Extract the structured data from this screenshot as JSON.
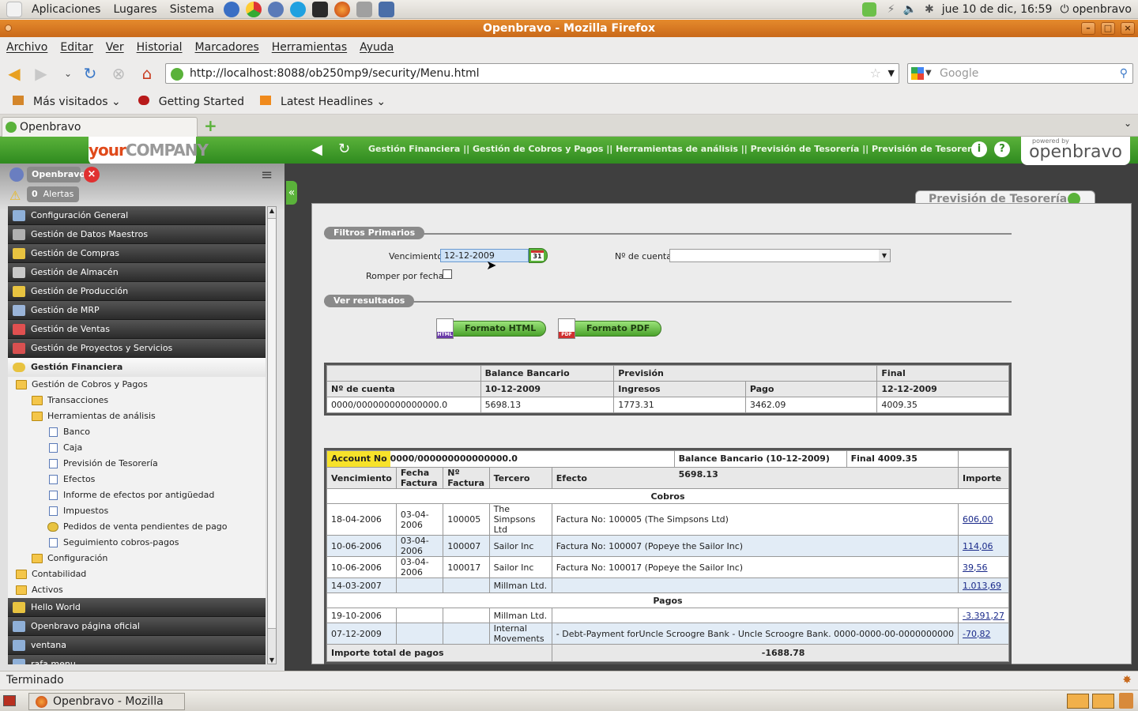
{
  "panel": {
    "menus": [
      "Aplicaciones",
      "Lugares",
      "Sistema"
    ],
    "datetime": "jue 10 de dic, 16:59",
    "user": "openbravo"
  },
  "window_title": "Openbravo - Mozilla Firefox",
  "firefox": {
    "menus": [
      "Archivo",
      "Editar",
      "Ver",
      "Historial",
      "Marcadores",
      "Herramientas",
      "Ayuda"
    ],
    "url": "http://localhost:8088/ob250mp9/security/Menu.html",
    "search_placeholder": "Google",
    "bookmarks": [
      "Más visitados",
      "Getting Started",
      "Latest Headlines"
    ],
    "tab_title": "Openbravo",
    "status": "Terminado",
    "taskbar_item": "Openbravo - Mozilla Fi..."
  },
  "ob": {
    "logo_your": "your",
    "logo_company": "COMPANY",
    "breadcrumb": "Gestión Financiera || Gestión de Cobros y Pagos || Herramientas de análisis || Previsión de Tesorería  ||  Previsión de Tesorería",
    "powered_by": "powered by",
    "powered_brand": "openbravo",
    "user": "Openbravo",
    "alerts_count": "0",
    "alerts_label": "Alertas",
    "window_tab": "Previsión de Tesorería"
  },
  "menu": {
    "top": [
      {
        "label": "Configuración General",
        "color": "#8fb0d8"
      },
      {
        "label": "Gestión de Datos Maestros",
        "color": "#b0b0b0"
      },
      {
        "label": "Gestión de Compras",
        "color": "#e8c340"
      },
      {
        "label": "Gestión de Almacén",
        "color": "#c8c8c8"
      },
      {
        "label": "Gestión de Producción",
        "color": "#e8c340"
      },
      {
        "label": "Gestión de MRP",
        "color": "#9ab4d8"
      },
      {
        "label": "Gestión de Ventas",
        "color": "#e05050"
      },
      {
        "label": "Gestión de Proyectos y Servicios",
        "color": "#d85050"
      }
    ],
    "finance_label": "Gestión Financiera",
    "tree": [
      {
        "label": "Gestión de Cobros y Pagos",
        "indent": 0,
        "kind": "fold"
      },
      {
        "label": "Transacciones",
        "indent": 1,
        "kind": "fold"
      },
      {
        "label": "Herramientas de análisis",
        "indent": 1,
        "kind": "fold"
      },
      {
        "label": "Banco",
        "indent": 2,
        "kind": "page"
      },
      {
        "label": "Caja",
        "indent": 2,
        "kind": "page"
      },
      {
        "label": "Previsión de Tesorería",
        "indent": 2,
        "kind": "page"
      },
      {
        "label": "Efectos",
        "indent": 2,
        "kind": "page"
      },
      {
        "label": "Informe de efectos por antigüedad",
        "indent": 2,
        "kind": "page"
      },
      {
        "label": "Impuestos",
        "indent": 2,
        "kind": "page"
      },
      {
        "label": "Pedidos de venta pendientes de pago",
        "indent": 2,
        "kind": "proc"
      },
      {
        "label": "Seguimiento cobros-pagos",
        "indent": 2,
        "kind": "page"
      },
      {
        "label": "Configuración",
        "indent": 1,
        "kind": "fold"
      },
      {
        "label": "Contabilidad",
        "indent": 0,
        "kind": "fold"
      },
      {
        "label": "Activos",
        "indent": 0,
        "kind": "fold"
      }
    ],
    "bottom": [
      {
        "label": "Hello World",
        "color": "#e8c340"
      },
      {
        "label": "Openbravo página oficial",
        "color": "#8fb0d8"
      },
      {
        "label": "ventana",
        "color": "#8fb0d8"
      },
      {
        "label": "rafa menu",
        "color": "#8fb0d8"
      }
    ]
  },
  "filters": {
    "section_primary": "Filtros Primarios",
    "vencimiento_label": "Vencimiento",
    "vencimiento_value": "12-12-2009",
    "cal_icon_text": "31",
    "cuenta_label": "Nº de cuenta",
    "cuenta_value": "",
    "romper_label": "Romper por fecha",
    "section_results": "Ver resultados",
    "btn_html": "Formato HTML",
    "btn_pdf": "Formato PDF",
    "html_tag": "HTML",
    "pdf_tag": "PDF"
  },
  "summary": {
    "h1": [
      "",
      "Balance Bancario",
      "Previsión",
      "Final"
    ],
    "h2": [
      "Nº de cuenta",
      "10-12-2009",
      "Ingresos",
      "Pago",
      "12-12-2009"
    ],
    "row": [
      "0000/000000000000000.0",
      "5698.13",
      "1773.31",
      "3462.09",
      "4009.35"
    ]
  },
  "detail": {
    "account_label": "Account No",
    "account_value": "0000/000000000000000.0",
    "balance": "Balance Bancario (10-12-2009) 5698.13",
    "final": "Final 4009.35",
    "headers": [
      "Vencimiento",
      "Fecha Factura",
      "Nº Factura",
      "Tercero",
      "Efecto",
      "Importe"
    ],
    "cobros_label": "Cobros",
    "cobros": [
      [
        "18-04-2006",
        "03-04-2006",
        "100005",
        "The Simpsons Ltd",
        "Factura No: 100005 (The Simpsons Ltd)",
        "606,00"
      ],
      [
        "10-06-2006",
        "03-04-2006",
        "100007",
        "Sailor Inc",
        "Factura No: 100007 (Popeye the Sailor Inc)",
        "114,06"
      ],
      [
        "10-06-2006",
        "03-04-2006",
        "100017",
        "Sailor Inc",
        "Factura No: 100017 (Popeye the Sailor Inc)",
        "39,56"
      ],
      [
        "14-03-2007",
        "",
        "",
        "Millman Ltd.",
        "",
        "1.013,69"
      ]
    ],
    "pagos_label": "Pagos",
    "pagos": [
      [
        "19-10-2006",
        "",
        "",
        "Millman Ltd.",
        "",
        "-3.391,27"
      ],
      [
        "07-12-2009",
        "",
        "",
        "Internal Movements",
        "- Debt-Payment forUncle Scroogre Bank - Uncle Scroogre Bank. 0000-0000-00-0000000000",
        "-70,82"
      ]
    ],
    "total_label": "Importe total de pagos",
    "total_value": "-1688.78"
  }
}
